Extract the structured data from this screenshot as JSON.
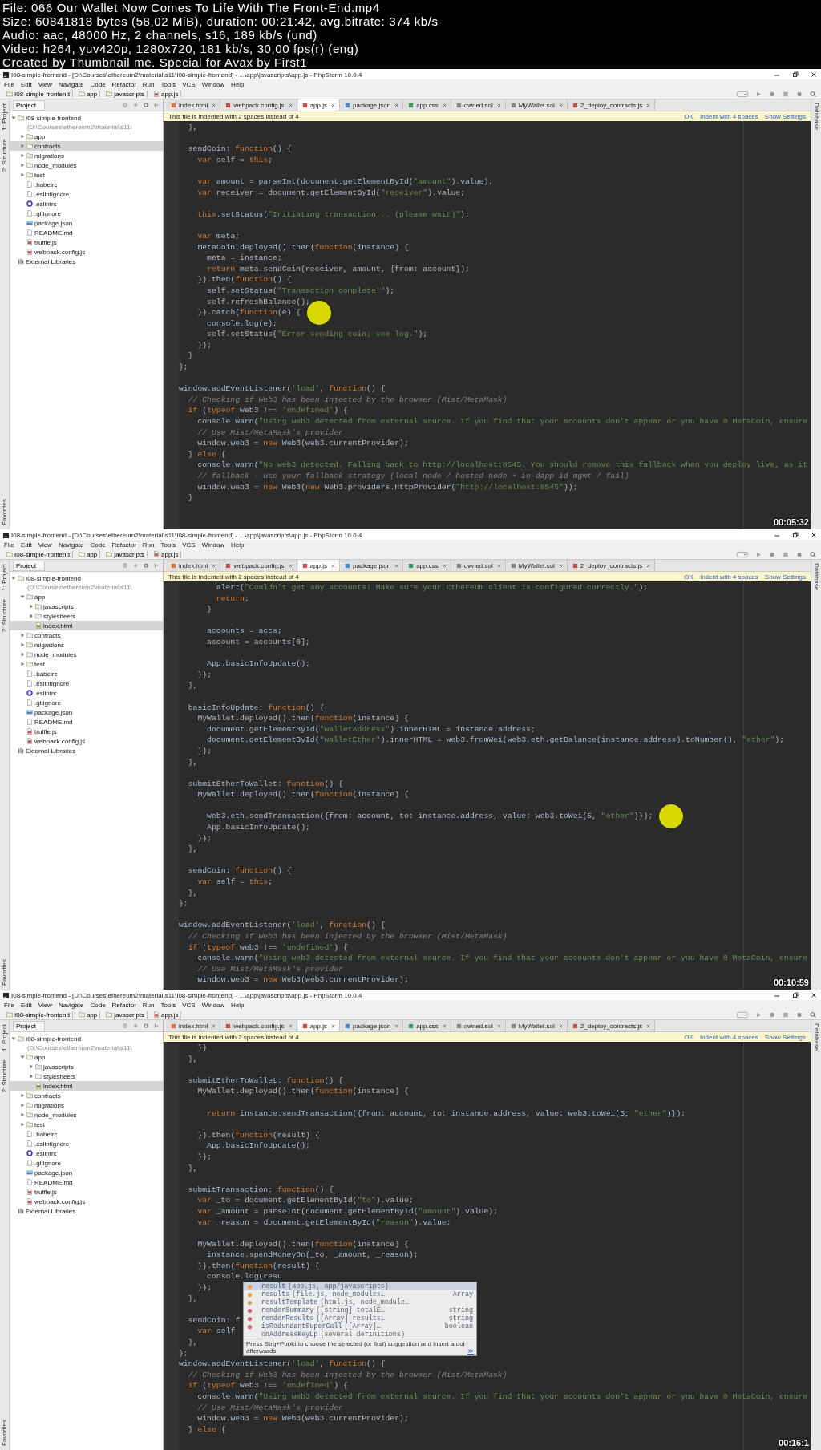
{
  "info_lines": [
    "File: 066 Our Wallet Now Comes To Life With The Front-End.mp4",
    "Size: 60841818 bytes (58,02 MiB), duration: 00:21:42, avg.bitrate: 374 kb/s",
    "Audio: aac, 48000 Hz, 2 channels, s16, 189 kb/s (und)",
    "Video: h264, yuv420p, 1280x720, 181 kb/s, 30,00 fps(r) (eng)",
    "Created by Thumbnail me. Special for Avax by First1"
  ],
  "frames": [
    {
      "title": "I08-simple-frontend - [D:\\Courses\\ethereum2\\material\\s11\\I08-simple-frontend] - ...\\app\\javascripts\\app.js - PhpStorm 10.0.4",
      "menu": [
        "File",
        "Edit",
        "View",
        "Navigate",
        "Code",
        "Refactor",
        "Run",
        "Tools",
        "VCS",
        "Window",
        "Help"
      ],
      "breadcrumb": [
        "I08-simple-frontend",
        "app",
        "javascripts",
        "app.js"
      ],
      "left_tool_tabs": [
        "1: Project",
        "2: Structure",
        "Favorites"
      ],
      "right_tool_tabs": [
        "Database"
      ],
      "project_label": "Project",
      "tabs": [
        {
          "label": "index.html",
          "kind": "html",
          "selected": false
        },
        {
          "label": "webpack.config.js",
          "kind": "js",
          "selected": false
        },
        {
          "label": "app.js",
          "kind": "js",
          "selected": true
        },
        {
          "label": "package.json",
          "kind": "json",
          "selected": false
        },
        {
          "label": "app.css",
          "kind": "css",
          "selected": false
        },
        {
          "label": "owned.sol",
          "kind": "sol",
          "selected": false
        },
        {
          "label": "MyWallet.sol",
          "kind": "sol",
          "selected": false
        },
        {
          "label": "2_deploy_contracts.js",
          "kind": "js",
          "selected": false
        }
      ],
      "tree": [
        {
          "label": "I08-simple-frontend",
          "path": "(D:\\Courses\\ethereum2\\material\\s11\\",
          "kind": "folder",
          "expanded": true,
          "selected": false,
          "children": [
            {
              "label": "app",
              "kind": "folder",
              "expanded": false,
              "selected": false
            },
            {
              "label": "contracts",
              "kind": "folder",
              "expanded": false,
              "selected": true
            },
            {
              "label": "migrations",
              "kind": "folder",
              "expanded": false,
              "selected": false
            },
            {
              "label": "node_modules",
              "kind": "folder",
              "expanded": false,
              "selected": false
            },
            {
              "label": "test",
              "kind": "folder",
              "expanded": false,
              "selected": false
            },
            {
              "label": ".babelrc",
              "kind": "file",
              "selected": false
            },
            {
              "label": ".eslintignore",
              "kind": "file",
              "selected": false
            },
            {
              "label": ".eslintrc",
              "kind": "eslint",
              "selected": false
            },
            {
              "label": ".gitignore",
              "kind": "file",
              "selected": false
            },
            {
              "label": "package.json",
              "kind": "json",
              "selected": false
            },
            {
              "label": "README.md",
              "kind": "file",
              "selected": false
            },
            {
              "label": "truffle.js",
              "kind": "js",
              "selected": false
            },
            {
              "label": "webpack.config.js",
              "kind": "js",
              "selected": false
            }
          ]
        },
        {
          "label": "External Libraries",
          "kind": "library",
          "selected": false
        }
      ],
      "notification": {
        "text": "This file is indented with 2 spaces instead of 4",
        "actions": [
          "OK",
          "Indent with 4 spaces",
          "Show Settings"
        ]
      },
      "code": [
        [
          "  },"
        ],
        [
          "  sendCoin: function() {",
          "    var self = this;"
        ],
        [
          "    var amount = parseInt(document.getElementById(\"amount\").value);",
          "    var receiver = document.getElementById(\"receiver\").value;"
        ],
        [
          "    this.setStatus(\"Initiating transaction... (please wait)\");"
        ],
        [
          "    var meta;",
          "    MetaCoin.deployed().then(function(instance) {",
          "      meta = instance;",
          "      return meta.sendCoin(receiver, amount, {from: account});",
          "    }).then(function() {",
          "      self.setStatus(\"Transaction complete!\");",
          "      self.refreshBalance();",
          {
            "text": "    }).catch(function(e) {",
            "pointer": true
          },
          "      console.log(e);",
          "      self.setStatus(\"Error sending coin; see log.\");",
          "    });",
          "  }",
          "};"
        ],
        [
          "window.addEventListener('load', function() {",
          "  // Checking if Web3 has been injected by the browser (Mist/MetaMask)",
          "  if (typeof web3 !== 'undefined') {",
          "    console.warn(\"Using web3 detected from external source. If you find that your accounts don't appear or you have 0 MetaCoin, ensure",
          "    // Use Mist/MetaMask's provider",
          "    window.web3 = new Web3(web3.currentProvider);",
          "  } else {",
          "    console.warn(\"No web3 detected. Falling back to http://localhost:8545. You should remove this fallback when you deploy live, as it",
          "    // fallback - use your fallback strategy (local node / hosted node + in-dapp id mgmt / fail)",
          "    window.web3 = new Web3(new Web3.providers.HttpProvider(\"http://localhost:8545\"));",
          "  }"
        ]
      ],
      "timestamp": "00:05:32"
    },
    {
      "title": "I08-simple-frontend - [D:\\Courses\\ethereum2\\material\\s11\\I08-simple-frontend] - ...\\app\\javascripts\\app.js - PhpStorm 10.0.4",
      "menu": [
        "File",
        "Edit",
        "View",
        "Navigate",
        "Code",
        "Refactor",
        "Run",
        "Tools",
        "VCS",
        "Window",
        "Help"
      ],
      "breadcrumb": [
        "I08-simple-frontend",
        "app",
        "javascripts",
        "app.js"
      ],
      "left_tool_tabs": [
        "1: Project",
        "2: Structure",
        "Favorites"
      ],
      "right_tool_tabs": [
        "Database"
      ],
      "project_label": "Project",
      "tabs": [
        {
          "label": "index.html",
          "kind": "html",
          "selected": false
        },
        {
          "label": "webpack.config.js",
          "kind": "js",
          "selected": false
        },
        {
          "label": "app.js",
          "kind": "js",
          "selected": true
        },
        {
          "label": "package.json",
          "kind": "json",
          "selected": false
        },
        {
          "label": "app.css",
          "kind": "css",
          "selected": false
        },
        {
          "label": "owned.sol",
          "kind": "sol",
          "selected": false
        },
        {
          "label": "MyWallet.sol",
          "kind": "sol",
          "selected": false
        },
        {
          "label": "2_deploy_contracts.js",
          "kind": "js",
          "selected": false
        }
      ],
      "tree": [
        {
          "label": "I08-simple-frontend",
          "path": "(D:\\Courses\\ethereum2\\material\\s11\\",
          "kind": "folder",
          "expanded": true,
          "selected": false,
          "children": [
            {
              "label": "app",
              "kind": "folder",
              "expanded": true,
              "selected": false,
              "children": [
                {
                  "label": "javascripts",
                  "kind": "folder",
                  "expanded": false,
                  "selected": false
                },
                {
                  "label": "stylesheets",
                  "kind": "folder",
                  "expanded": false,
                  "selected": false
                },
                {
                  "label": "index.html",
                  "kind": "html",
                  "selected": true
                }
              ]
            },
            {
              "label": "contracts",
              "kind": "folder",
              "expanded": false,
              "selected": false
            },
            {
              "label": "migrations",
              "kind": "folder",
              "expanded": false,
              "selected": false
            },
            {
              "label": "node_modules",
              "kind": "folder",
              "expanded": false,
              "selected": false
            },
            {
              "label": "test",
              "kind": "folder",
              "expanded": false,
              "selected": false
            },
            {
              "label": ".babelrc",
              "kind": "file",
              "selected": false
            },
            {
              "label": ".eslintignore",
              "kind": "file",
              "selected": false
            },
            {
              "label": ".eslintrc",
              "kind": "eslint",
              "selected": false
            },
            {
              "label": ".gitignore",
              "kind": "file",
              "selected": false
            },
            {
              "label": "package.json",
              "kind": "json",
              "selected": false
            },
            {
              "label": "README.md",
              "kind": "file",
              "selected": false
            },
            {
              "label": "truffle.js",
              "kind": "js",
              "selected": false
            },
            {
              "label": "webpack.config.js",
              "kind": "js",
              "selected": false
            }
          ]
        },
        {
          "label": "External Libraries",
          "kind": "library",
          "selected": false
        }
      ],
      "notification": {
        "text": "This file is indented with 2 spaces instead of 4",
        "actions": [
          "OK",
          "Indent with 4 spaces",
          "Show Settings"
        ]
      },
      "code": [
        [
          "        alert(\"Couldn't get any accounts! Make sure your Ethereum client is configured correctly.\");",
          "        return;",
          "      }"
        ],
        [
          "      accounts = accs;",
          "      account = accounts[0];"
        ],
        [
          "      App.basicInfoUpdate();",
          "    });",
          "  },"
        ],
        [
          "  basicInfoUpdate: function() {",
          "    MyWallet.deployed().then(function(instance) {",
          "      document.getElementById(\"walletAddress\").innerHTML = instance.address;",
          "      document.getElementById(\"walletEther\").innerHTML = web3.fromWei(web3.eth.getBalance(instance.address).toNumber(), \"ether\");",
          "    });",
          "  },"
        ],
        [
          "  submitEtherToWallet: function() {",
          "    MyWallet.deployed().then(function(instance) {"
        ],
        [
          {
            "text": "      web3.eth.sendTransaction({from: account, to: instance.address, value: web3.toWei(5, \"ether\")});",
            "pointer": true
          },
          "      App.basicInfoUpdate();",
          "    });",
          "  },"
        ],
        [
          "  sendCoin: function() {",
          "    var self = this;",
          "  },",
          "};"
        ],
        [
          "window.addEventListener('load', function() {",
          "  // Checking if Web3 has been injected by the browser (Mist/MetaMask)",
          "  if (typeof web3 !== 'undefined') {",
          "    console.warn(\"Using web3 detected from external source. If you find that your accounts don't appear or you have 0 MetaCoin, ensure",
          "    // Use Mist/MetaMask's provider",
          "    window.web3 = new Web3(web3.currentProvider);"
        ]
      ],
      "timestamp": "00:10:59"
    },
    {
      "title": "I08-simple-frontend - [D:\\Courses\\ethereum2\\material\\s11\\I08-simple-frontend] - ...\\app\\javascripts\\app.js - PhpStorm 10.0.4",
      "menu": [
        "File",
        "Edit",
        "View",
        "Navigate",
        "Code",
        "Refactor",
        "Run",
        "Tools",
        "VCS",
        "Window",
        "Help"
      ],
      "breadcrumb": [
        "I08-simple-frontend",
        "app",
        "javascripts",
        "app.js"
      ],
      "left_tool_tabs": [
        "1: Project",
        "2: Structure",
        "Favorites"
      ],
      "right_tool_tabs": [
        "Database"
      ],
      "project_label": "Project",
      "tabs": [
        {
          "label": "index.html",
          "kind": "html",
          "selected": false
        },
        {
          "label": "webpack.config.js",
          "kind": "js",
          "selected": false
        },
        {
          "label": "app.js",
          "kind": "js",
          "selected": true
        },
        {
          "label": "package.json",
          "kind": "json",
          "selected": false
        },
        {
          "label": "app.css",
          "kind": "css",
          "selected": false
        },
        {
          "label": "owned.sol",
          "kind": "sol",
          "selected": false
        },
        {
          "label": "MyWallet.sol",
          "kind": "sol",
          "selected": false
        },
        {
          "label": "2_deploy_contracts.js",
          "kind": "js",
          "selected": false
        }
      ],
      "tree": [
        {
          "label": "I08-simple-frontend",
          "path": "(D:\\Courses\\ethereum2\\material\\s11\\",
          "kind": "folder",
          "expanded": true,
          "selected": false,
          "children": [
            {
              "label": "app",
              "kind": "folder",
              "expanded": true,
              "selected": false,
              "children": [
                {
                  "label": "javascripts",
                  "kind": "folder",
                  "expanded": false,
                  "selected": false
                },
                {
                  "label": "stylesheets",
                  "kind": "folder",
                  "expanded": false,
                  "selected": false
                },
                {
                  "label": "index.html",
                  "kind": "html",
                  "selected": true
                }
              ]
            },
            {
              "label": "contracts",
              "kind": "folder",
              "expanded": false,
              "selected": false
            },
            {
              "label": "migrations",
              "kind": "folder",
              "expanded": false,
              "selected": false
            },
            {
              "label": "node_modules",
              "kind": "folder",
              "expanded": false,
              "selected": false
            },
            {
              "label": "test",
              "kind": "folder",
              "expanded": false,
              "selected": false
            },
            {
              "label": ".babelrc",
              "kind": "file",
              "selected": false
            },
            {
              "label": ".eslintignore",
              "kind": "file",
              "selected": false
            },
            {
              "label": ".eslintrc",
              "kind": "eslint",
              "selected": false
            },
            {
              "label": ".gitignore",
              "kind": "file",
              "selected": false
            },
            {
              "label": "package.json",
              "kind": "json",
              "selected": false
            },
            {
              "label": "README.md",
              "kind": "file",
              "selected": false
            },
            {
              "label": "truffle.js",
              "kind": "js",
              "selected": false
            },
            {
              "label": "webpack.config.js",
              "kind": "js",
              "selected": false
            }
          ]
        },
        {
          "label": "External Libraries",
          "kind": "library",
          "selected": false
        }
      ],
      "notification": {
        "text": "This file is indented with 2 spaces instead of 4",
        "actions": [
          "OK",
          "Indent with 4 spaces",
          "Show Settings"
        ]
      },
      "code": [
        [
          "    })",
          "  },"
        ],
        [
          "  submitEtherToWallet: function() {",
          "    MyWallet.deployed().then(function(instance) {"
        ],
        [
          "      return instance.sendTransaction({from: account, to: instance.address, value: web3.toWei(5, \"ether\")});"
        ],
        [
          "    }).then(function(result) {",
          "      App.basicInfoUpdate();",
          "    });",
          "  },"
        ],
        [
          "  submitTransaction: function() {",
          "    var _to = document.getElementById(\"to\").value;",
          "    var _amount = parseInt(document.getElementById(\"amount\").value);",
          "    var _reason = document.getElementById(\"reason\").value;"
        ],
        [
          "    MyWallet.deployed().then(function(instance) {",
          "      instance.spendMoneyOn(_to, _amount, _reason);",
          "    }).then(function(result) {",
          "      console.log(resu",
          "    });",
          "  },"
        ],
        [
          "  sendCoin: f",
          "    var self",
          "  },",
          "};",
          "window.addEventListener('load', function() {",
          "  // Checking if Web3 has been injected by the browser (Mist/MetaMask)",
          "  if (typeof web3 !== 'undefined') {",
          "    console.warn(\"Using web3 detected from external source. If you find that your accounts don't appear or you have 0 MetaCoin, ensure",
          "    // Use Mist/MetaMask's provider",
          "    window.web3 = new Web3(web3.currentProvider);",
          "  } else {"
        ]
      ],
      "completion": {
        "items": [
          {
            "name": "result",
            "detail": "(app.js, app/javascripts)",
            "kind": "variable",
            "selected": true
          },
          {
            "name": "results",
            "detail": "(file.js, node_modules…",
            "type": "Array",
            "kind": "variable",
            "selected": false
          },
          {
            "name": "resultTemplate",
            "detail": "(html.js, node_module…",
            "kind": "field",
            "selected": false
          },
          {
            "name": "renderSummary",
            "detail": "([string] totalE…",
            "type": "string",
            "kind": "method",
            "selected": false
          },
          {
            "name": "renderResults",
            "detail": "([Array] results…",
            "type": "string",
            "kind": "method",
            "selected": false
          },
          {
            "name": "isRedundantSuperCall",
            "detail": "([Array]…",
            "type": "boolean",
            "kind": "method",
            "selected": false
          },
          {
            "name": "onAddressKeyUp",
            "detail": "(several definitions)",
            "kind": "other",
            "selected": false
          }
        ],
        "hint": "Press Strg+Punkt to choose the selected (or first) suggestion and insert a dot afterwards",
        "hint_link": "≫"
      },
      "timestamp": "00:16:1"
    }
  ]
}
